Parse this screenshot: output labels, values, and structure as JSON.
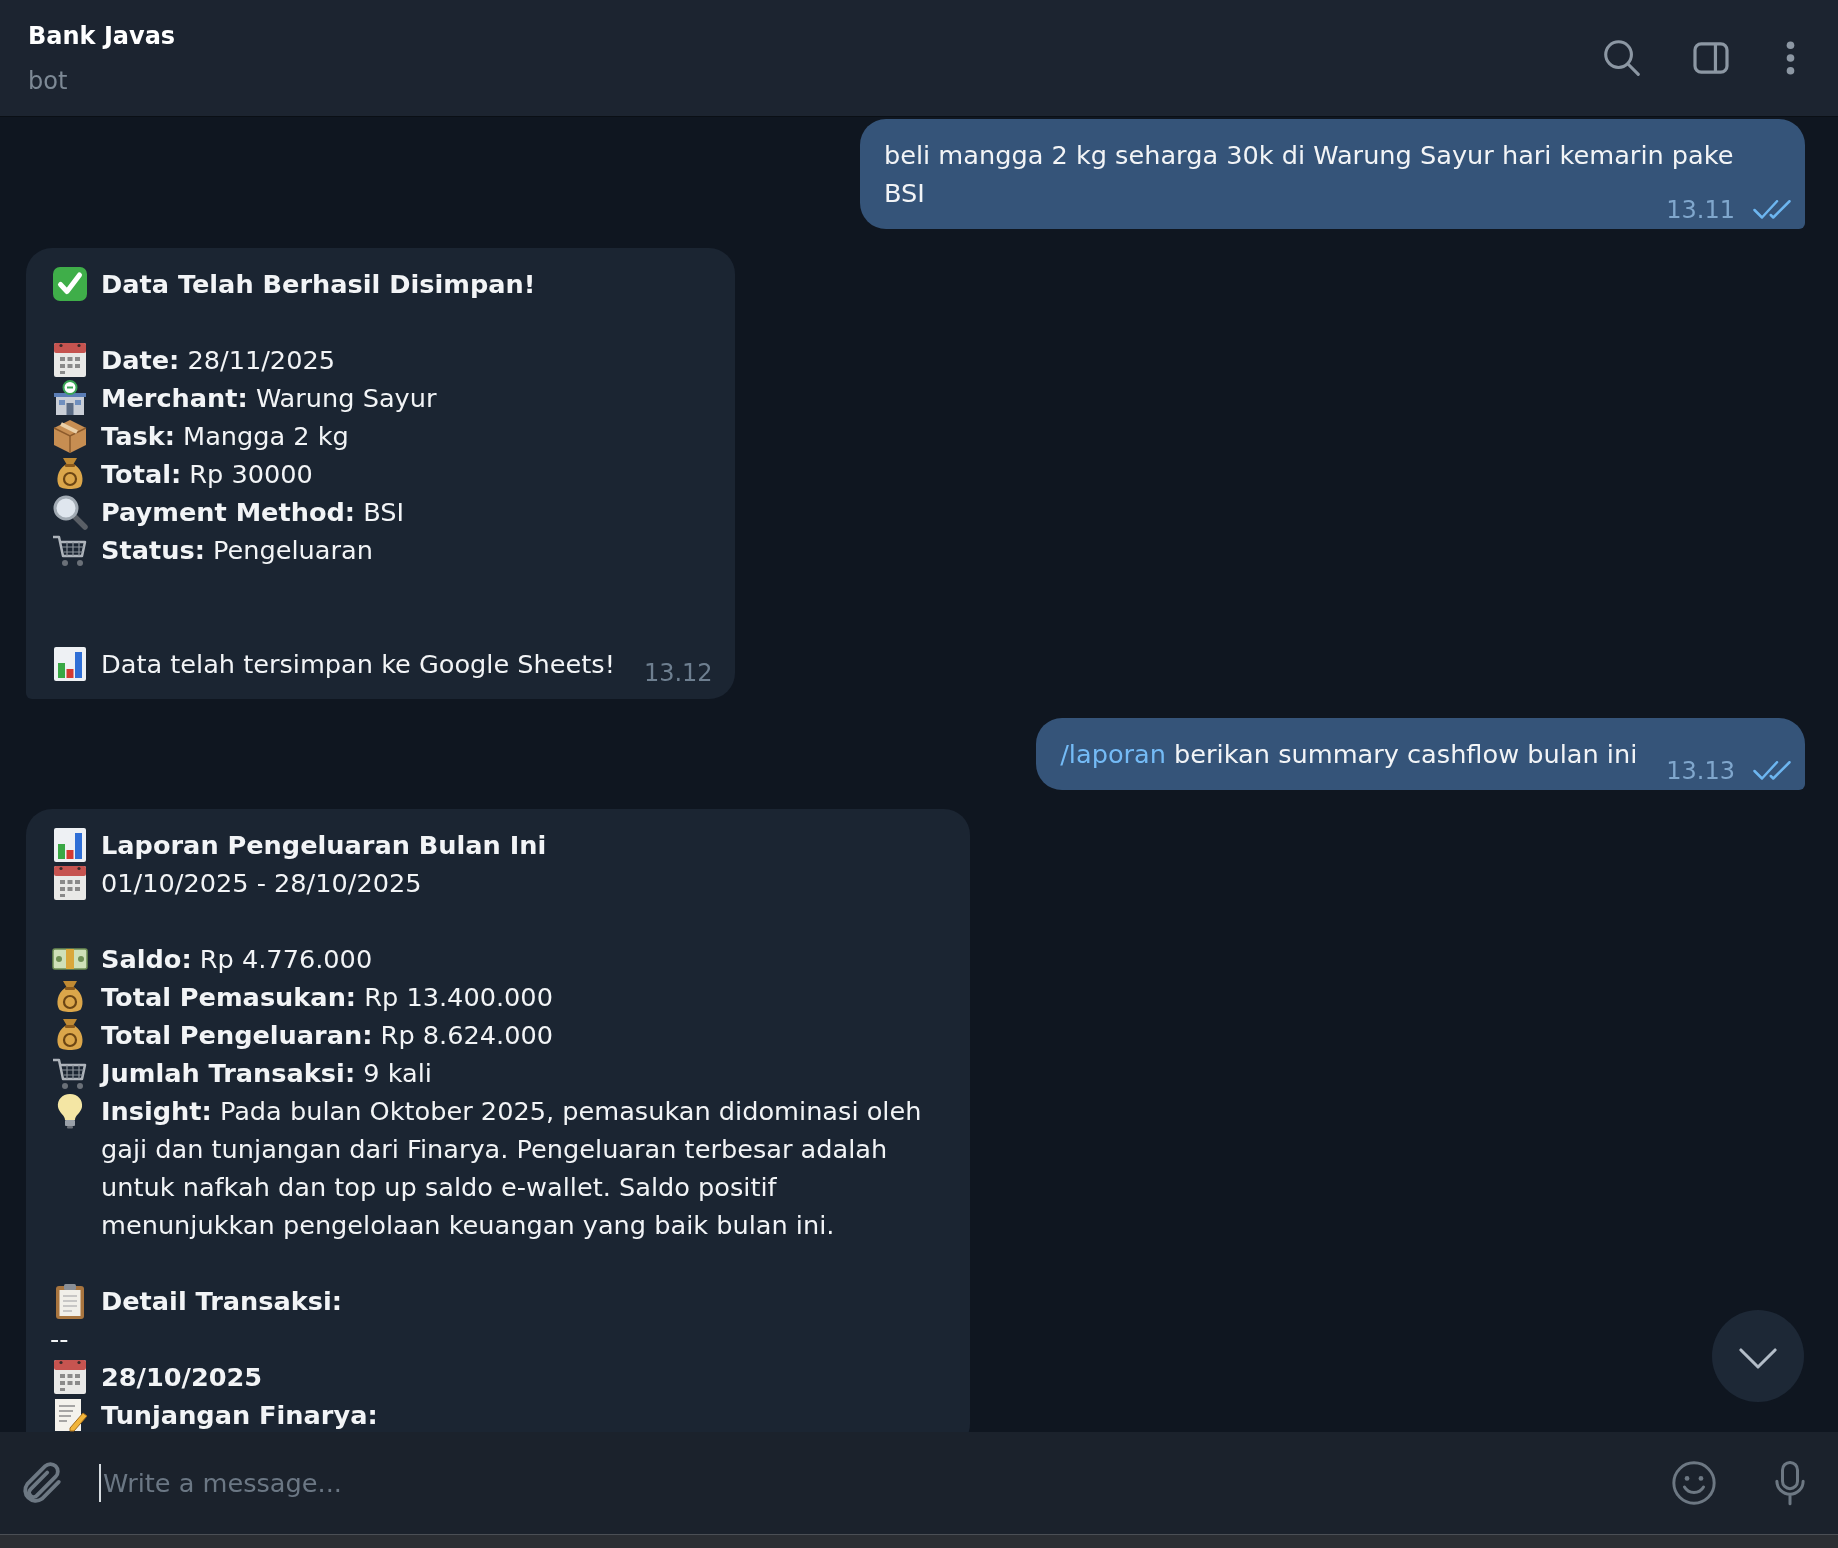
{
  "header": {
    "title": "Bank Javas",
    "subtitle": "bot"
  },
  "messages": [
    {
      "kind": "outgoing",
      "text": "beli mangga 2 kg seharga 30k di Warung Sayur hari kemarin pake BSI",
      "time": "13.11",
      "read": true
    },
    {
      "kind": "incoming",
      "time": "13.12",
      "lines": [
        {
          "kind": "saved",
          "label": "Data Telah Berhasil Disimpan!"
        },
        {
          "kind": "blank"
        },
        {
          "kind": "date",
          "label": "Date:",
          "value": "28/11/2025"
        },
        {
          "kind": "merchant",
          "label": "Merchant:",
          "value": "Warung Sayur"
        },
        {
          "kind": "task",
          "label": "Task:",
          "value": "Mangga 2 kg"
        },
        {
          "kind": "money",
          "label": "Total:",
          "value": "Rp 30000"
        },
        {
          "kind": "payment",
          "label": "Payment Method:",
          "value": "BSI"
        },
        {
          "kind": "status",
          "label": "Status:",
          "value": "Pengeluaran"
        },
        {
          "kind": "blank"
        },
        {
          "kind": "blank"
        },
        {
          "kind": "sheet",
          "value": "Data telah tersimpan ke Google Sheets!"
        }
      ]
    },
    {
      "kind": "outgoing",
      "command": "/laporan",
      "text": "berikan summary cashflow bulan ini",
      "time": "13.13",
      "read": true
    },
    {
      "kind": "incoming",
      "lines": [
        {
          "kind": "report",
          "label": "Laporan Pengeluaran Bulan Ini"
        },
        {
          "kind": "date",
          "value": "01/10/2025 - 28/10/2025"
        },
        {
          "kind": "blank"
        },
        {
          "kind": "balance",
          "label": "Saldo:",
          "value": "Rp 4.776.000"
        },
        {
          "kind": "money",
          "label": "Total Pemasukan:",
          "value": "Rp 13.400.000"
        },
        {
          "kind": "money",
          "label": "Total Pengeluaran:",
          "value": "Rp 8.624.000"
        },
        {
          "kind": "count",
          "label": "Jumlah Transaksi:",
          "value": "9 kali"
        },
        {
          "kind": "insight",
          "label": "Insight:",
          "value": "Pada bulan Oktober 2025, pemasukan didominasi oleh gaji dan tunjangan dari Finarya. Pengeluaran terbesar adalah untuk nafkah dan top up saldo e-wallet. Saldo positif menunjukkan pengelolaan keuangan yang baik bulan ini."
        },
        {
          "kind": "blank"
        },
        {
          "kind": "details",
          "label": "Detail Transaksi:"
        },
        {
          "kind": "plain",
          "value": "--"
        },
        {
          "kind": "date",
          "label": "28/10/2025"
        },
        {
          "kind": "note",
          "label": "Tunjangan Finarya:"
        }
      ]
    }
  ],
  "composer": {
    "placeholder": "Write a message..."
  }
}
